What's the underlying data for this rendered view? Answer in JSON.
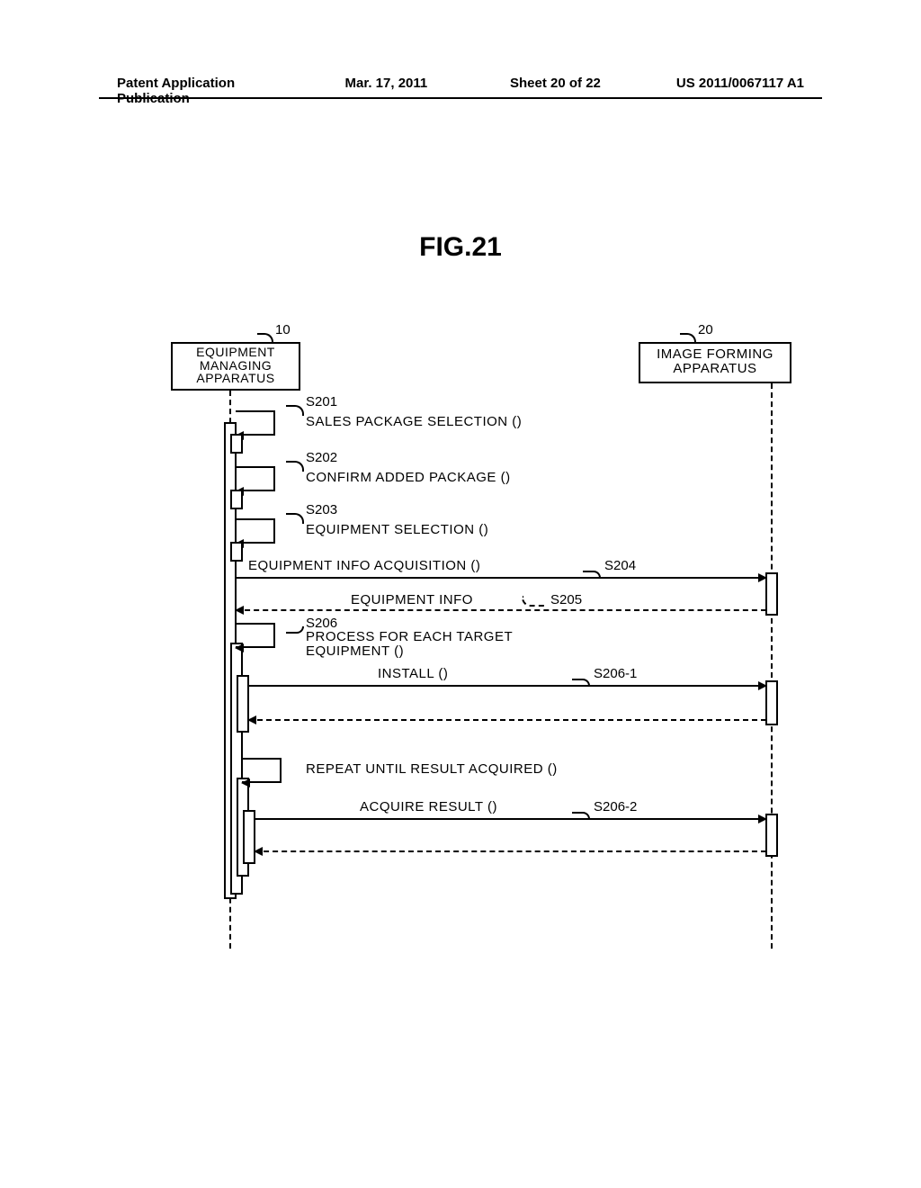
{
  "header": {
    "pubtype": "Patent Application Publication",
    "date": "Mar. 17, 2011",
    "sheet": "Sheet 20 of 22",
    "pubnum": "US 2011/0067117 A1"
  },
  "figure_title": "FIG.21",
  "participants": {
    "left_ref": "10",
    "left_box_l1": "EQUIPMENT",
    "left_box_l2": "MANAGING",
    "left_box_l3": "APPARATUS",
    "right_ref": "20",
    "right_box_l1": "IMAGE FORMING",
    "right_box_l2": "APPARATUS"
  },
  "steps": {
    "s201_id": "S201",
    "s201_label": "SALES PACKAGE SELECTION ()",
    "s202_id": "S202",
    "s202_label": "CONFIRM ADDED PACKAGE ()",
    "s203_id": "S203",
    "s203_label": "EQUIPMENT SELECTION ()",
    "s204_id": "S204",
    "s204_label": "EQUIPMENT INFO ACQUISITION ()",
    "s205_id": "S205",
    "s205_label": "EQUIPMENT INFO",
    "s206_id": "S206",
    "s206_label_l1": "PROCESS FOR EACH TARGET",
    "s206_label_l2": "EQUIPMENT ()",
    "s206_1_id": "S206-1",
    "s206_1_label": "INSTALL ()",
    "repeat_label": "REPEAT UNTIL RESULT ACQUIRED ()",
    "s206_2_id": "S206-2",
    "s206_2_label": "ACQUIRE RESULT ()"
  }
}
